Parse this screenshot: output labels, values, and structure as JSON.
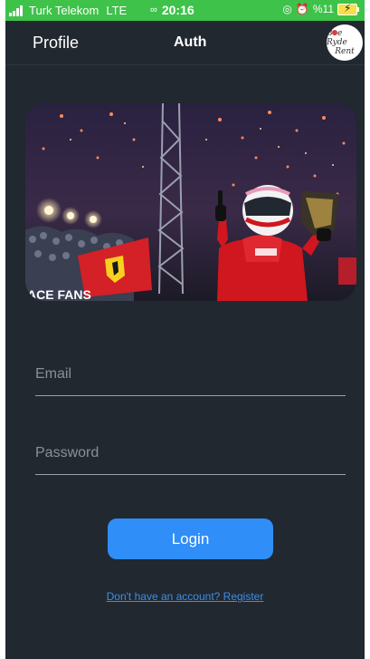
{
  "status_bar": {
    "carrier": "Turk Telekom",
    "network": "LTE",
    "time": "20:16",
    "battery_text": "%11",
    "icons": [
      "signal-icon",
      "link-icon",
      "alarm-icon",
      "location-icon",
      "battery-charging-icon"
    ]
  },
  "nav": {
    "profile_label": "Profile",
    "title": "Auth",
    "logo_line1": "Bee Ryde",
    "logo_line2": "Rent"
  },
  "hero": {
    "icon": "race-celebration-photo"
  },
  "form": {
    "email_placeholder": "Email",
    "email_value": "",
    "password_placeholder": "Password",
    "password_value": "",
    "login_label": "Login",
    "register_link": "Don't have an account? Register"
  },
  "colors": {
    "status_bar": "#3fc24a",
    "background": "#212830",
    "accent": "#2f8ef7",
    "link": "#3d8ee6"
  }
}
